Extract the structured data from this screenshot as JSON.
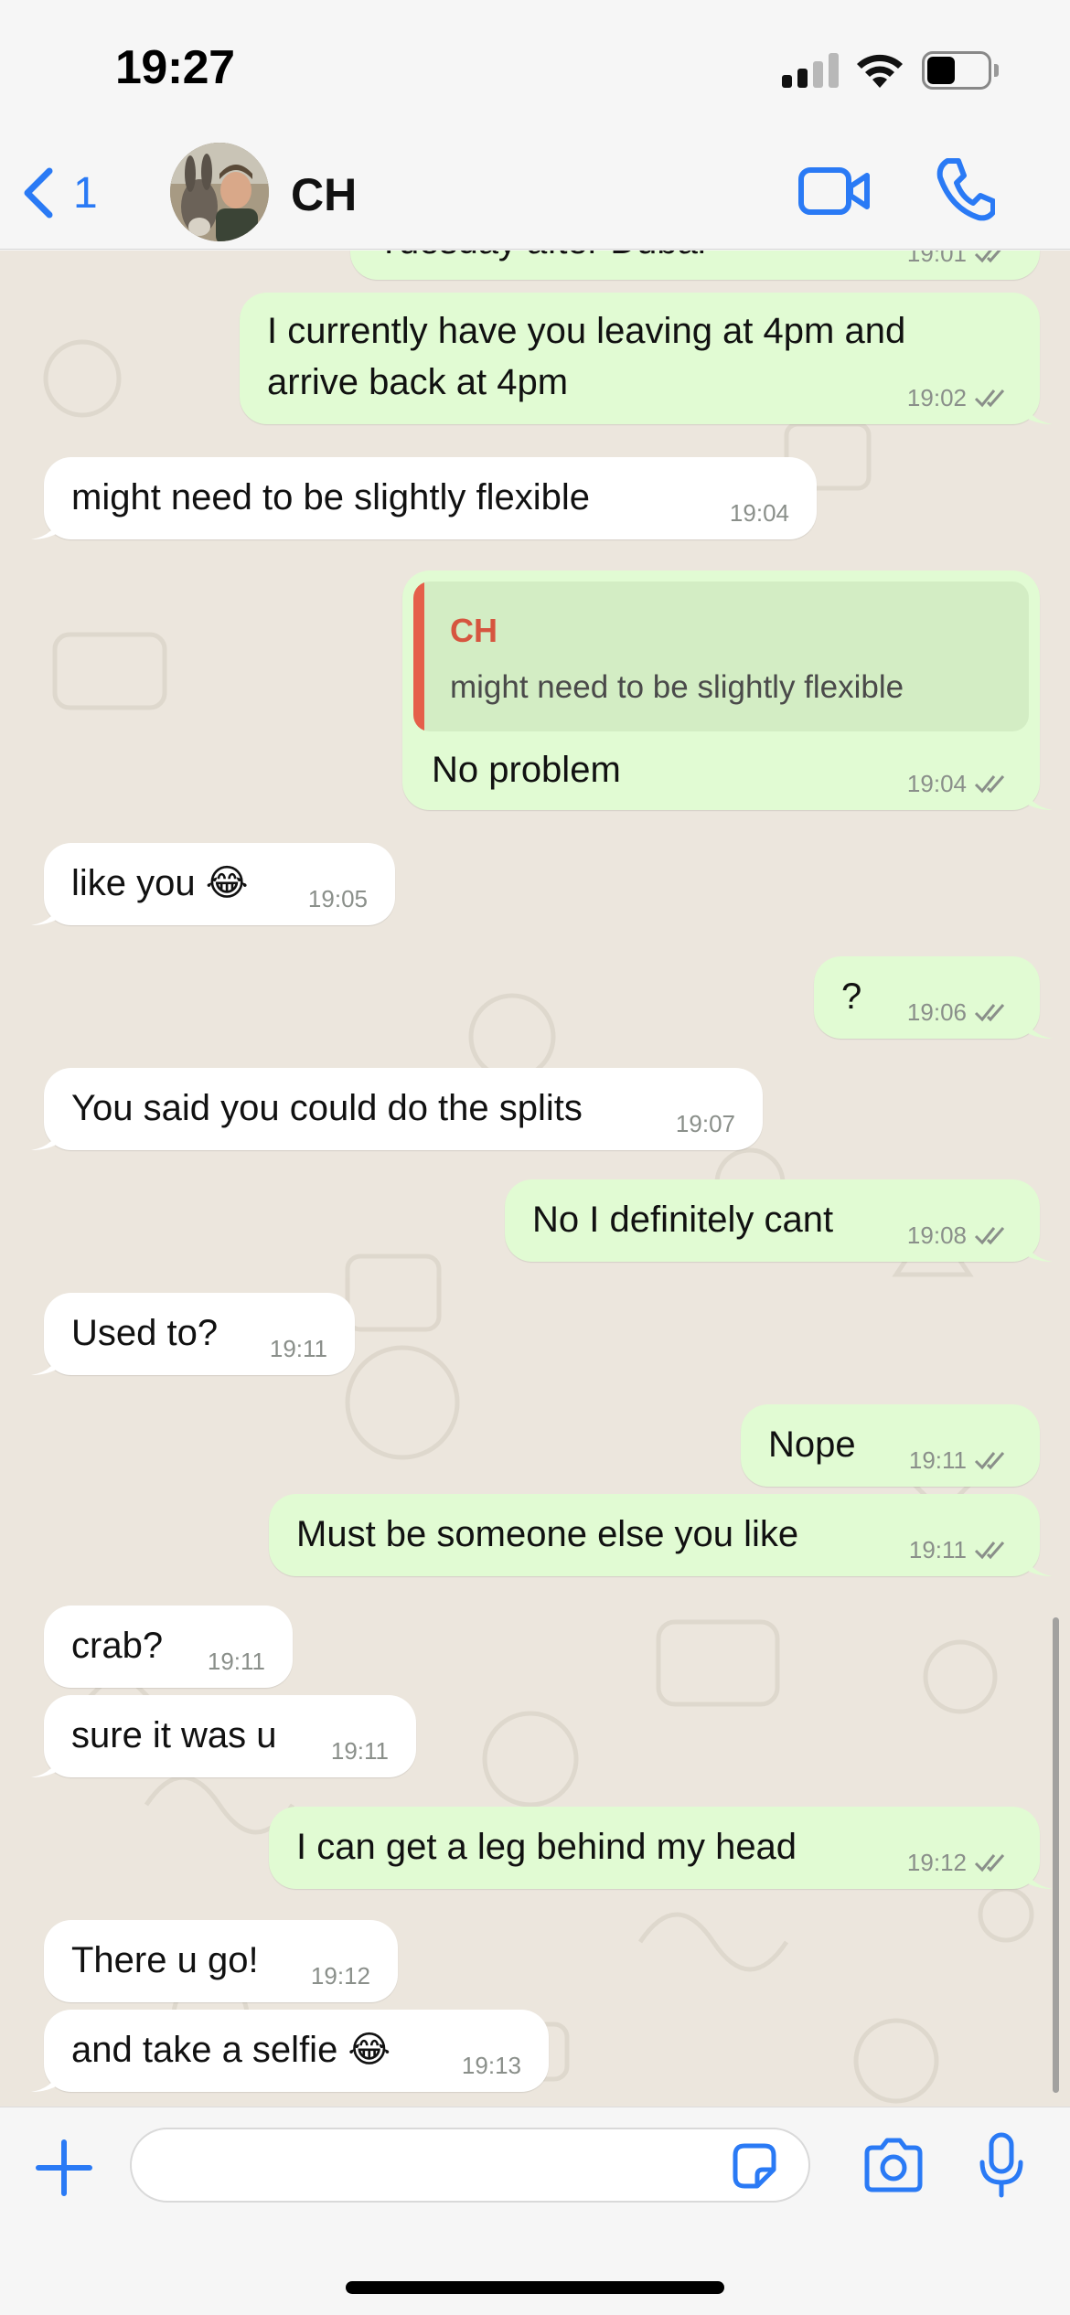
{
  "status_bar": {
    "time": "19:27"
  },
  "header": {
    "back_count": "1",
    "contact_name": "CH"
  },
  "messages": [
    {
      "dir": "out",
      "text": "Tuesday after Dubai",
      "time": "19:01",
      "partial": true
    },
    {
      "dir": "out",
      "text_line1": "I currently have you leaving at 4pm and",
      "text_line2": "arrive back at 4pm",
      "time": "19:02"
    },
    {
      "dir": "in",
      "text": "might need to be slightly flexible",
      "time": "19:04"
    },
    {
      "dir": "out",
      "reply_author": "CH",
      "reply_text": "might need to be slightly flexible",
      "text": "No problem",
      "time": "19:04"
    },
    {
      "dir": "in",
      "text": "like you 😂",
      "time": "19:05"
    },
    {
      "dir": "out",
      "text": "?",
      "time": "19:06"
    },
    {
      "dir": "in",
      "text": "You said you could do the splits",
      "time": "19:07"
    },
    {
      "dir": "out",
      "text": "No I definitely cant",
      "time": "19:08"
    },
    {
      "dir": "in",
      "text": "Used to?",
      "time": "19:11"
    },
    {
      "dir": "out",
      "text": "Nope",
      "time": "19:11"
    },
    {
      "dir": "out",
      "text": "Must be someone else you like",
      "time": "19:11"
    },
    {
      "dir": "in",
      "text": "crab?",
      "time": "19:11"
    },
    {
      "dir": "in",
      "text": "sure it was u",
      "time": "19:11"
    },
    {
      "dir": "out",
      "text": "I can get a leg behind my head",
      "time": "19:12"
    },
    {
      "dir": "in",
      "text": "There u go!",
      "time": "19:12"
    },
    {
      "dir": "in",
      "text": "and take a selfie 😂",
      "time": "19:13"
    }
  ],
  "colors": {
    "accent": "#2a7af5",
    "outgoing_bubble": "#e1fbd3",
    "incoming_bubble": "#ffffff",
    "chat_background": "#ece6dd",
    "reply_author": "#d6553f"
  },
  "icons": {
    "back": "chevron-left-icon",
    "video": "video-camera-icon",
    "call": "phone-icon",
    "plus": "plus-icon",
    "sticker": "sticker-icon",
    "camera": "camera-icon",
    "mic": "microphone-icon",
    "read_receipt": "double-check-icon"
  },
  "input": {
    "value": "",
    "placeholder": ""
  }
}
